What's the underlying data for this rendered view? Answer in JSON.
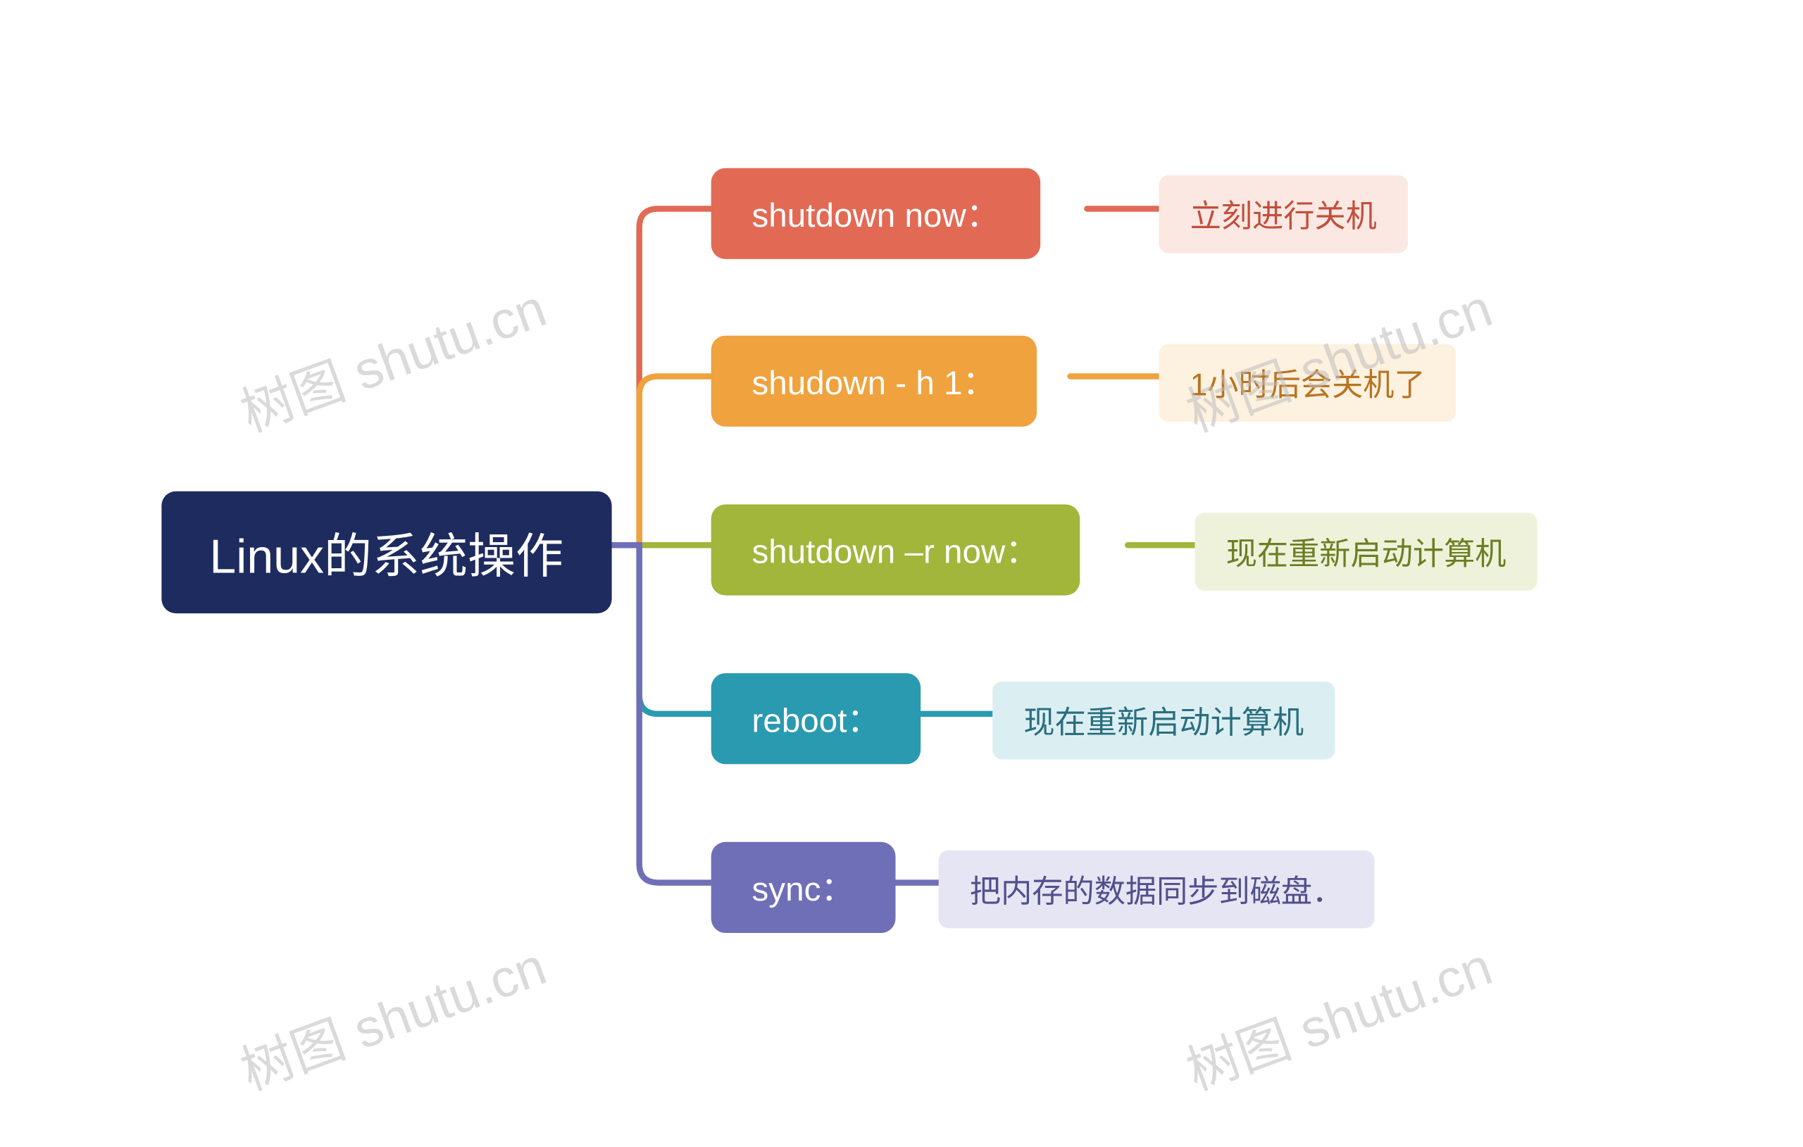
{
  "root": {
    "label": "Linux的系统操作"
  },
  "branches": [
    {
      "label": "shutdown now：",
      "color": "#e26a55",
      "leaf": {
        "label": "立刻进行关机",
        "bg": "#fbe8e2",
        "fg": "#c24f3d"
      }
    },
    {
      "label": "shudown  - h 1：",
      "color": "#efa23d",
      "leaf": {
        "label": "1小时后会关机了",
        "bg": "#fdf1df",
        "fg": "#b77423"
      }
    },
    {
      "label": "shutdown –r now：",
      "color": "#a1b63b",
      "leaf": {
        "label": "现在重新启动计算机",
        "bg": "#eef2db",
        "fg": "#6c7e22"
      }
    },
    {
      "label": "reboot：",
      "color": "#2a9ab0",
      "leaf": {
        "label": "现在重新启动计算机",
        "bg": "#dbeff3",
        "fg": "#2a6e7e"
      }
    },
    {
      "label": "sync：",
      "color": "#6f6fb8",
      "leaf": {
        "label": "把内存的数据同步到磁盘．",
        "bg": "#e6e5f3",
        "fg": "#514f8c"
      }
    }
  ],
  "watermark": "树图 shutu.cn"
}
